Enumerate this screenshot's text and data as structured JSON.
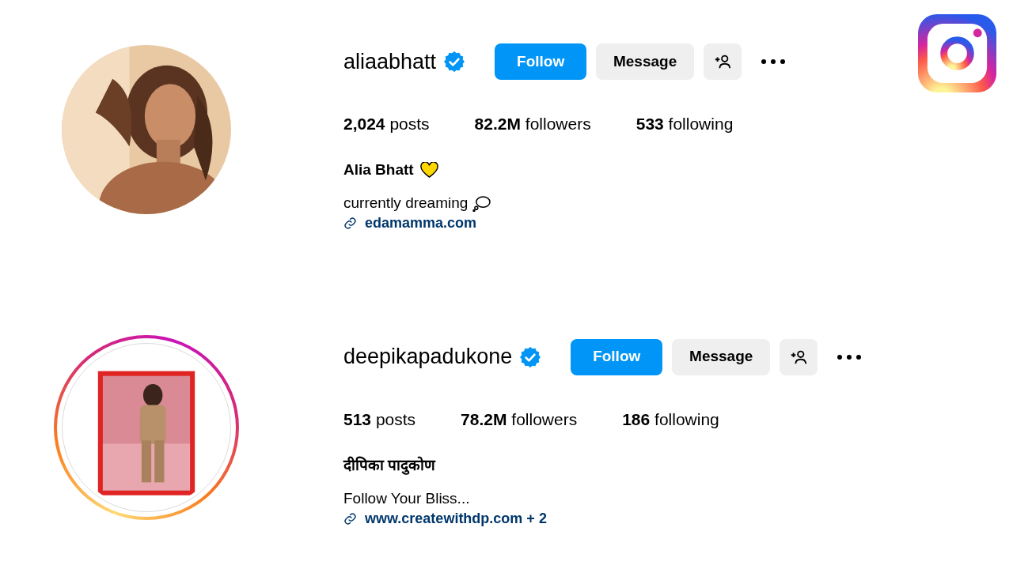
{
  "profiles": [
    {
      "username": "aliaabhatt",
      "verified": true,
      "story_ring": false,
      "buttons": {
        "follow": "Follow",
        "message": "Message"
      },
      "stats": [
        {
          "count": "2,024",
          "label": "posts"
        },
        {
          "count": "82.2M",
          "label": "followers"
        },
        {
          "count": "533",
          "label": "following"
        }
      ],
      "name": "Alia Bhatt",
      "name_icon": true,
      "bio": "currently dreaming",
      "bio_icon": true,
      "link": "edamamma.com"
    },
    {
      "username": "deepikapadukone",
      "verified": true,
      "story_ring": true,
      "buttons": {
        "follow": "Follow",
        "message": "Message"
      },
      "stats": [
        {
          "count": "513",
          "label": "posts"
        },
        {
          "count": "78.2M",
          "label": "followers"
        },
        {
          "count": "186",
          "label": "following"
        }
      ],
      "name": "दीपिका पादुकोण",
      "name_icon": false,
      "bio": "Follow Your Bliss...",
      "bio_icon": false,
      "link": "www.createwithdp.com + 2"
    }
  ]
}
